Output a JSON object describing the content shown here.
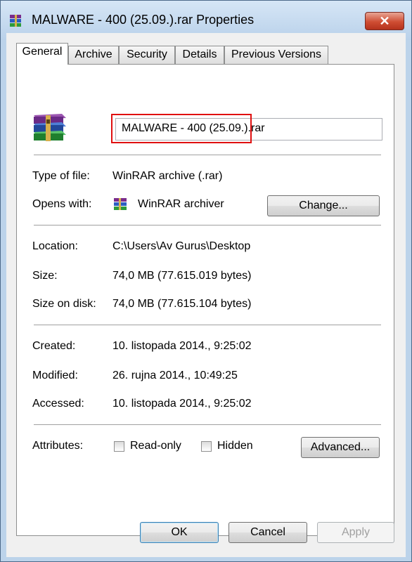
{
  "window": {
    "title": "MALWARE - 400 (25.09.).rar Properties",
    "close_label": "✕",
    "icon": "winrar-archive-icon"
  },
  "tabs": [
    {
      "label": "General",
      "active": true
    },
    {
      "label": "Archive"
    },
    {
      "label": "Security"
    },
    {
      "label": "Details"
    },
    {
      "label": "Previous Versions"
    }
  ],
  "file": {
    "name": "MALWARE - 400 (25.09.).rar",
    "icon": "winrar-archive-icon"
  },
  "type_section": {
    "type_label": "Type of file:",
    "type_value": "WinRAR archive (.rar)",
    "opens_label": "Opens with:",
    "opens_value": "WinRAR archiver",
    "opens_icon": "winrar-icon",
    "change_button": "Change..."
  },
  "location_section": {
    "location_label": "Location:",
    "location_value": "C:\\Users\\Av Gurus\\Desktop",
    "size_label": "Size:",
    "size_value": "74,0 MB (77.615.019 bytes)",
    "disk_label": "Size on disk:",
    "disk_value": "74,0 MB (77.615.104 bytes)"
  },
  "dates_section": {
    "created_label": "Created:",
    "created_value": "10. listopada 2014., 9:25:02",
    "modified_label": "Modified:",
    "modified_value": "26. rujna 2014., 10:49:25",
    "accessed_label": "Accessed:",
    "accessed_value": "10. listopada 2014., 9:25:02"
  },
  "attributes": {
    "label": "Attributes:",
    "readonly_label": "Read-only",
    "readonly_checked": false,
    "hidden_label": "Hidden",
    "hidden_checked": false,
    "advanced_button": "Advanced..."
  },
  "footer": {
    "ok_label": "OK",
    "cancel_label": "Cancel",
    "apply_label": "Apply"
  },
  "colors": {
    "highlight": "#e01010",
    "title_bar": "#c6dcf2",
    "close_button": "#cf4d33"
  }
}
